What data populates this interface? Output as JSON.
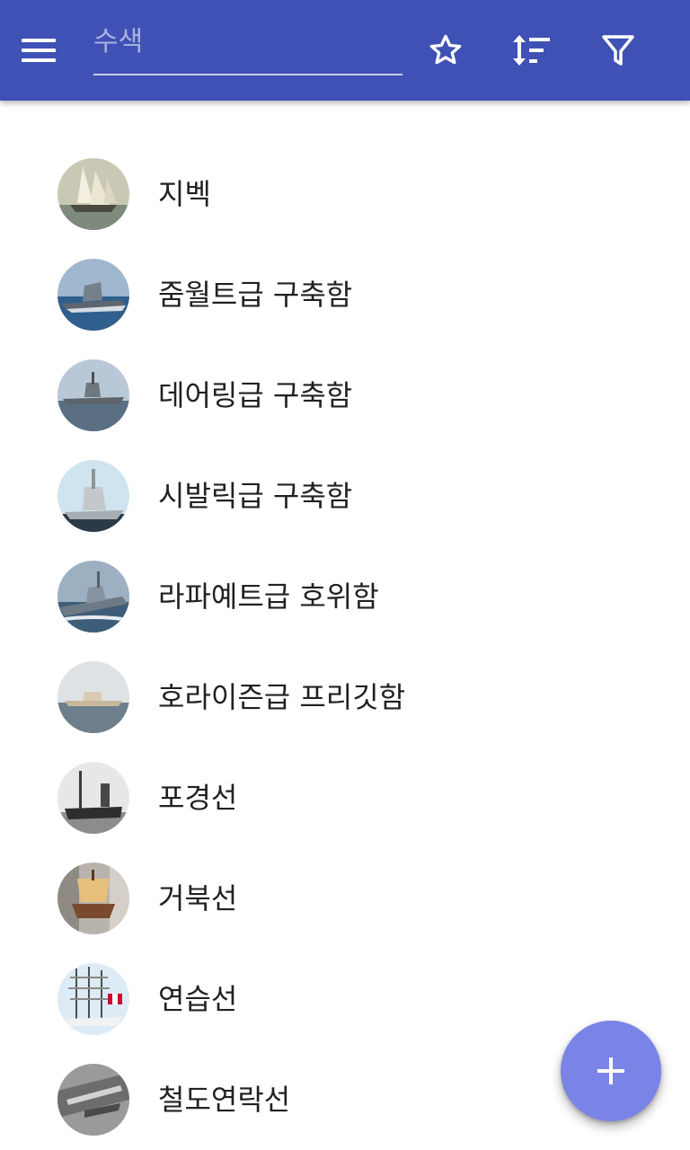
{
  "toolbar": {
    "menu_icon": "menu-icon",
    "search_placeholder": "수색",
    "search_value": "",
    "favorite_icon": "star-outline-icon",
    "sort_icon": "sort-icon",
    "filter_icon": "filter-icon",
    "background": "#3f51b5"
  },
  "items": [
    {
      "label": "지벡",
      "thumb": "sailing-ships"
    },
    {
      "label": "줌월트급 구축함",
      "thumb": "stealth-destroyer"
    },
    {
      "label": "데어링급 구축함",
      "thumb": "destroyer-grey"
    },
    {
      "label": "시발릭급 구축함",
      "thumb": "destroyer-sky"
    },
    {
      "label": "라파예트급 호위함",
      "thumb": "frigate-sea"
    },
    {
      "label": "호라이즌급 프리깃함",
      "thumb": "frigate-horizon"
    },
    {
      "label": "포경선",
      "thumb": "whaling-ship-bw"
    },
    {
      "label": "거북선",
      "thumb": "turtle-ship-model"
    },
    {
      "label": "연습선",
      "thumb": "training-tall-ship"
    },
    {
      "label": "철도연락선",
      "thumb": "railway-ferry-bw"
    }
  ],
  "fab": {
    "icon": "add-icon",
    "color": "#7a84e6"
  }
}
